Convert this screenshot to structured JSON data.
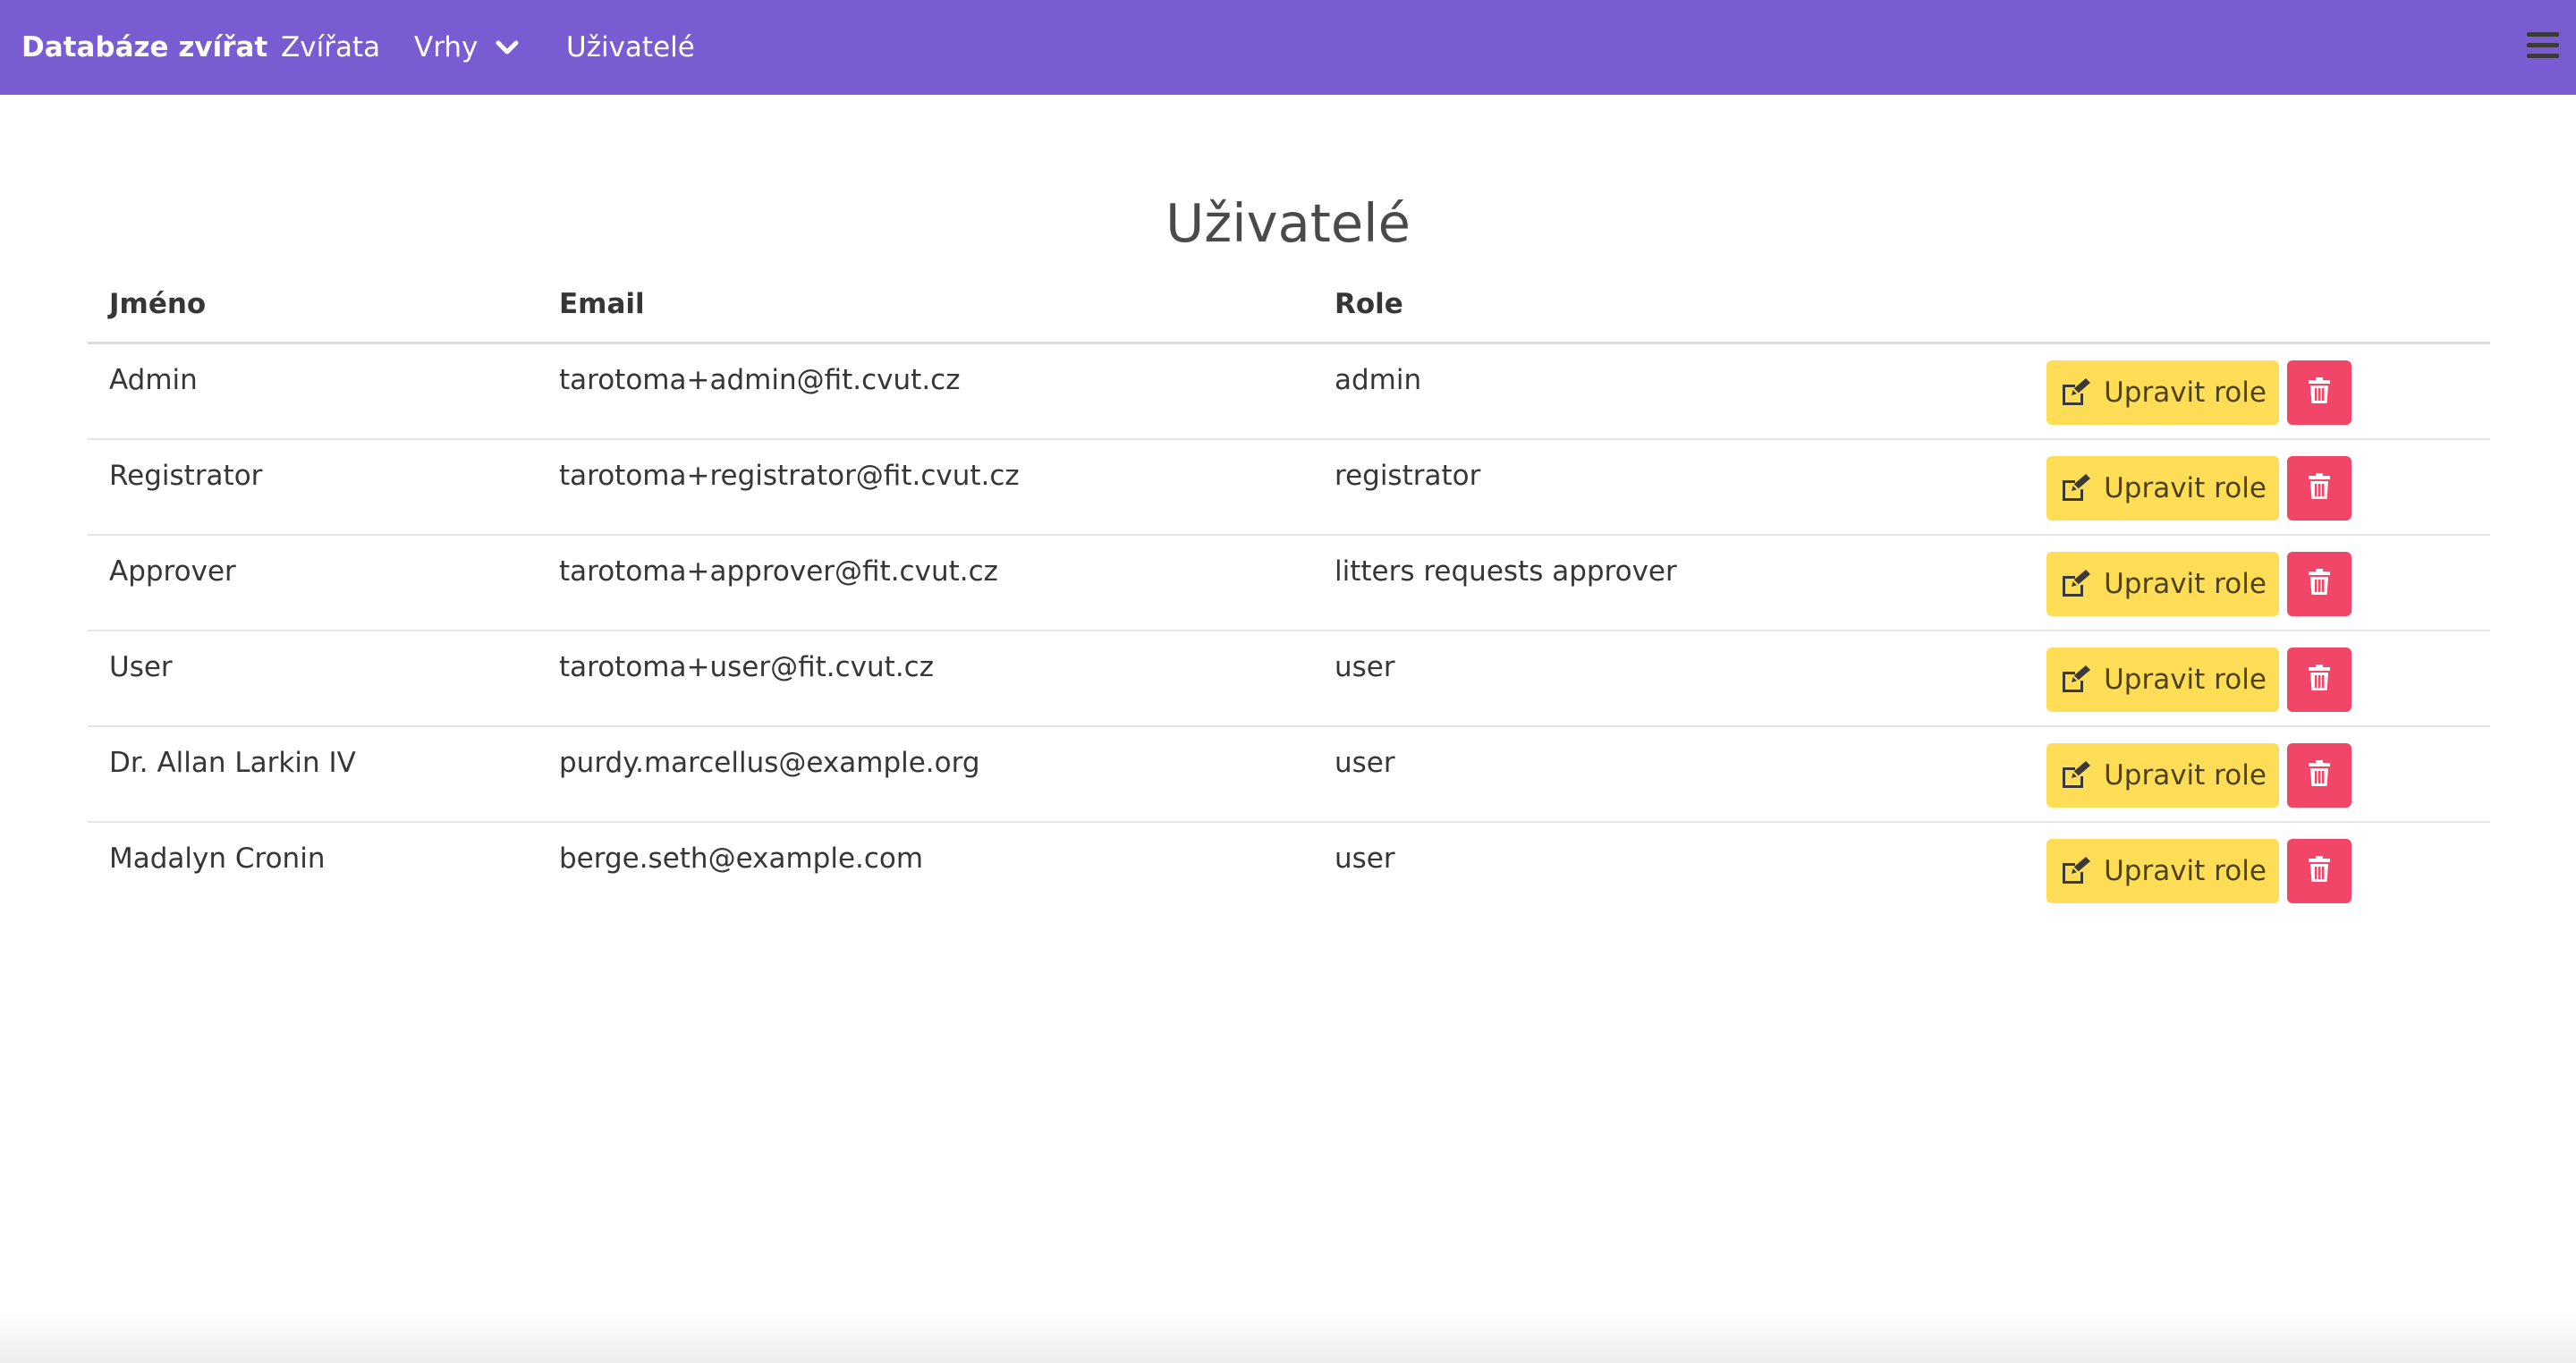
{
  "navbar": {
    "brand": "Databáze zvířat",
    "items": [
      {
        "label": "Zvířata"
      },
      {
        "label": "Vrhy",
        "has_dropdown": true
      },
      {
        "label": "Uživatelé"
      }
    ],
    "color": "#7a5cd2"
  },
  "page": {
    "title": "Uživatelé"
  },
  "table": {
    "headers": [
      "Jméno",
      "Email",
      "Role"
    ],
    "rows": [
      {
        "name": "Admin",
        "email": "tarotoma+admin@fit.cvut.cz",
        "role": "admin"
      },
      {
        "name": "Registrator",
        "email": "tarotoma+registrator@fit.cvut.cz",
        "role": "registrator"
      },
      {
        "name": "Approver",
        "email": "tarotoma+approver@fit.cvut.cz",
        "role": "litters requests approver"
      },
      {
        "name": "User",
        "email": "tarotoma+user@fit.cvut.cz",
        "role": "user"
      },
      {
        "name": "Dr. Allan Larkin IV",
        "email": "purdy.marcellus@example.org",
        "role": "user"
      },
      {
        "name": "Madalyn Cronin",
        "email": "berge.seth@example.com",
        "role": "user"
      }
    ],
    "edit_label": "Upravit role",
    "edit_icon": "edit-icon",
    "delete_icon": "trash-icon",
    "edit_color": "#ffdd57",
    "delete_color": "#f14668"
  }
}
